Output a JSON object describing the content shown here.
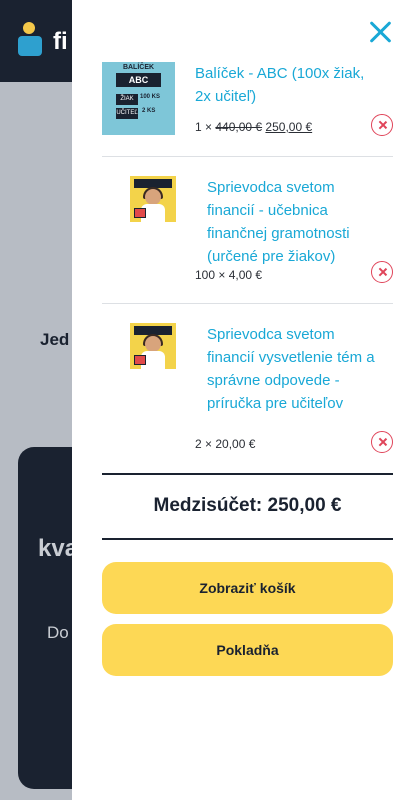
{
  "background": {
    "logo_text": "fi",
    "text1": "Jed",
    "card_title": "kva",
    "card_sub": "Do"
  },
  "cart": {
    "items": [
      {
        "title": "Balíček - ABC (100x žiak, 2x učiteľ)",
        "qty_prefix": "1 ×",
        "old_price": "440,00 €",
        "price": "250,00 €",
        "thumb": {
          "line1": "BALÍČEK",
          "line2": "ABC",
          "line3": "ŽIAK",
          "line4": "100 KS",
          "line5": "UČITEĽ",
          "line6": "2 KS"
        }
      },
      {
        "title": "Sprievodca svetom financií - učebnica finančnej gramotnosti (určené pre žiakov)",
        "qty_price": "100 × 4,00 €"
      },
      {
        "title": "Sprievodca svetom financií vysvetlenie tém a správne odpovede - príručka pre učiteľov",
        "qty_price": "2 × 20,00 €"
      }
    ],
    "subtotal_label": "Medzisúčet: 250,00 €",
    "view_cart_label": "Zobraziť košík",
    "checkout_label": "Pokladňa"
  },
  "colors": {
    "accent": "#19a8d6",
    "button": "#fdd855",
    "remove": "#e0455a",
    "dark": "#1a2230"
  }
}
